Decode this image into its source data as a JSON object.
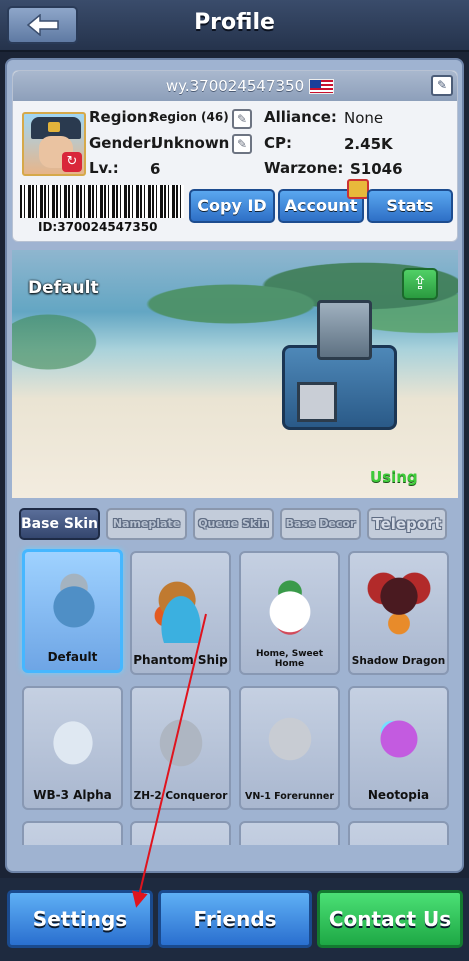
{
  "header": {
    "title": "Profile",
    "back_icon": "arrow-left-icon"
  },
  "profile": {
    "username": "wy.370024547350",
    "region_label": "Region:",
    "region_value": "Region (46)",
    "gender_label": "Gender:",
    "gender_value": "Unknown",
    "level_label": "Lv.:",
    "level_value": "6",
    "alliance_label": "Alliance:",
    "alliance_value": "None",
    "cp_label": "CP:",
    "cp_value": "2.45K",
    "warzone_label": "Warzone:",
    "warzone_value": "S1046",
    "id_text": "ID:370024547350",
    "buttons": {
      "copy_id": "Copy ID",
      "account": "Account",
      "stats": "Stats"
    }
  },
  "preview": {
    "label": "Default",
    "status": "Using"
  },
  "tabs": [
    "Base Skin",
    "Nameplate",
    "Queue Skin",
    "Base Decor",
    "Teleport"
  ],
  "skins": [
    {
      "name": "Default",
      "selected": true
    },
    {
      "name": "Phantom Ship"
    },
    {
      "name": "Home, Sweet Home"
    },
    {
      "name": "Shadow Dragon"
    },
    {
      "name": "WB-3 Alpha"
    },
    {
      "name": "ZH-2 Conqueror"
    },
    {
      "name": "VN-1 Forerunner"
    },
    {
      "name": "Neotopia"
    }
  ],
  "bottom": {
    "settings": "Settings",
    "friends": "Friends",
    "contact": "Contact Us"
  },
  "colors": {
    "accent_blue": "#2e6fc6",
    "accent_green": "#1ea845",
    "using_green": "#3fcb3a",
    "annotation_red": "#e0141e"
  }
}
